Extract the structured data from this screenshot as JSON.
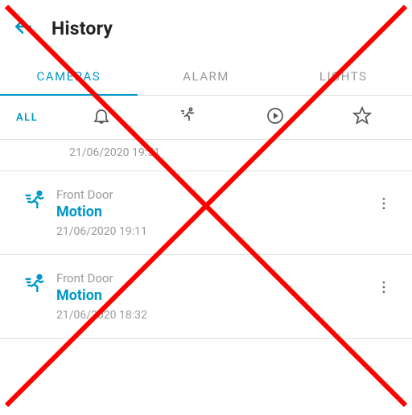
{
  "colors": {
    "accent": "#0098c8",
    "muted": "#9a9a9a",
    "overlay_stroke": "#ff0000"
  },
  "appbar": {
    "title": "History"
  },
  "tabs": {
    "cameras": "CAMERAS",
    "alarm": "ALARM",
    "lights": "LIGHTS",
    "active": "cameras"
  },
  "filters": {
    "all": "ALL"
  },
  "events": {
    "fragment_time": "21/06/2020 19:51",
    "items": [
      {
        "device": "Front Door",
        "type": "Motion",
        "time": "21/06/2020 19:11"
      },
      {
        "device": "Front Door",
        "type": "Motion",
        "time": "21/06/2020 18:32"
      }
    ]
  },
  "overlay": {
    "shape": "x-cross",
    "color": "#ff0000"
  }
}
